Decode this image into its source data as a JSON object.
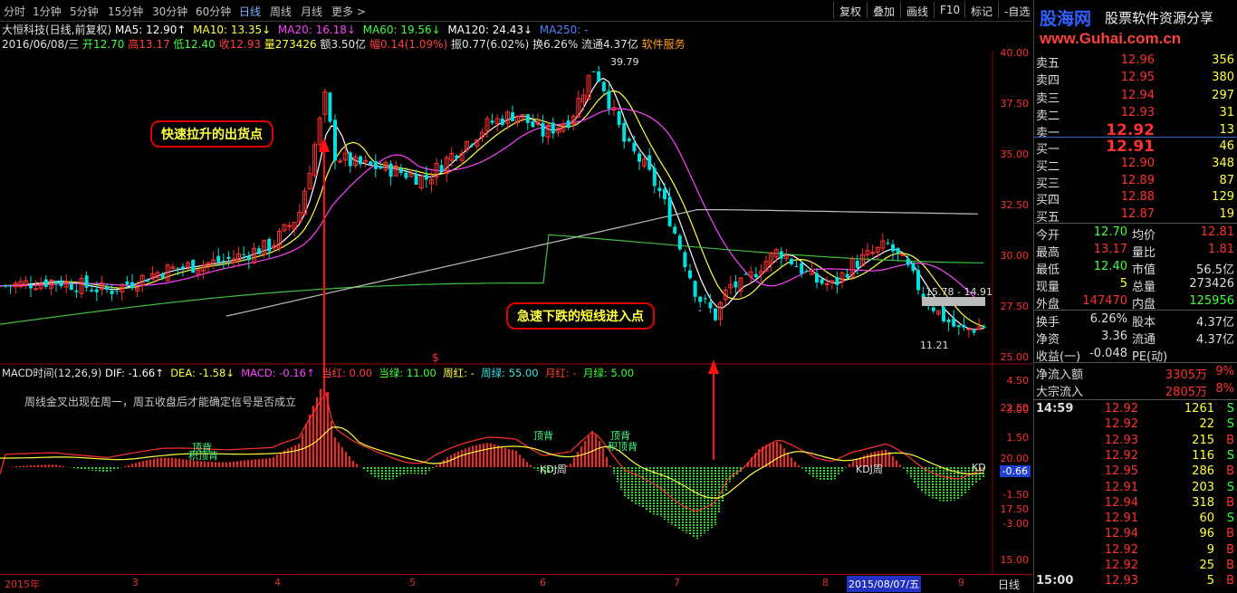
{
  "toolbar": {
    "items": [
      "分时",
      "1分钟",
      "5分钟",
      "15分钟",
      "30分钟",
      "60分钟",
      "日线",
      "周线",
      "月线",
      "更多 >"
    ],
    "right": [
      "复权",
      "叠加",
      "画线",
      "F10",
      "标记",
      "-自选"
    ]
  },
  "header": {
    "stock": "大恒科技(日线,前复权)",
    "ma5": "MA5: 12.90↑",
    "ma10": "MA10: 13.35↓",
    "ma20": "MA20: 16.18↓",
    "ma60": "MA60: 19.56↓",
    "ma120": "MA120: 24.43↓",
    "ma250": "MA250: -",
    "date": "2016/06/08/三",
    "open": "开12.70",
    "high": "高13.17",
    "low": "低12.40",
    "close": "收12.93",
    "vol": "量273426",
    "amount": "额3.50亿",
    "change": "幅0.14(1.09%)",
    "amp": "振0.77(6.02%)",
    "turnover": "换6.26%",
    "float": "流通4.37亿",
    "service": "软件服务"
  },
  "price_axis": [
    "40.00",
    "37.50",
    "35.00",
    "32.50",
    "30.00",
    "27.50",
    "25.00",
    "22.50",
    "20.00",
    "17.50",
    "15.00"
  ],
  "macd_axis": [
    "4.50",
    "3.00",
    "1.50",
    "-0.66",
    "-1.50",
    "-3.00"
  ],
  "annotations": {
    "callout_top": "快速拉升的出货点",
    "callout_bottom": "急速下跌的短线进入点",
    "peak_label": "39.79",
    "low_label": "11.21",
    "range_label": "15.78 - 14.91",
    "small_dash": "-"
  },
  "macd_header": {
    "name": "MACD时间(12,26,9)",
    "dif": "DIF: -1.66↑",
    "dea": "DEA: -1.58↓",
    "macd": "MACD: -0.16↑",
    "cur_red": "当红: 0.00",
    "cur_green": "当绿: 11.00",
    "week_red": "周红: -",
    "week_green": "周绿: 55.00",
    "month_red": "月红: -",
    "month_green": "月绿: 5.00"
  },
  "macd_notes": {
    "note": "周线金叉出现在周一，周五收盘后才能确定信号是否成立",
    "t1": "顶背",
    "t2": "积顶背",
    "t3": "顶背",
    "t4": "顶背",
    "t5": "积顶背",
    "kdj1": "KDJ周",
    "kdj2": "KDJ周",
    "kd": "KD",
    "dollar": "$"
  },
  "date_bar": {
    "labels": [
      "2015年",
      "3",
      "4",
      "5",
      "6",
      "7",
      "8",
      "2015/08/07/五",
      "9"
    ],
    "period": "日线"
  },
  "panel": {
    "logo": "股海网",
    "logo_sub": "股票软件资源分享",
    "url": "www.Guhai.com.cn",
    "asks": [
      {
        "label": "卖五",
        "price": "12.96",
        "vol": "356"
      },
      {
        "label": "卖四",
        "price": "12.95",
        "vol": "380"
      },
      {
        "label": "卖三",
        "price": "12.94",
        "vol": "297"
      },
      {
        "label": "卖二",
        "price": "12.93",
        "vol": "31"
      },
      {
        "label": "卖一",
        "price": "12.92",
        "vol": "13"
      }
    ],
    "bids": [
      {
        "label": "买一",
        "price": "12.91",
        "vol": "46"
      },
      {
        "label": "买二",
        "price": "12.90",
        "vol": "348"
      },
      {
        "label": "买三",
        "price": "12.89",
        "vol": "87"
      },
      {
        "label": "买四",
        "price": "12.88",
        "vol": "129"
      },
      {
        "label": "买五",
        "price": "12.87",
        "vol": "19"
      }
    ],
    "stats": [
      {
        "l1": "今开",
        "v1": "12.70",
        "l2": "均价",
        "v2": "12.81"
      },
      {
        "l1": "最高",
        "v1": "13.17",
        "l2": "量比",
        "v2": "1.81"
      },
      {
        "l1": "最低",
        "v1": "12.40",
        "l2": "市值",
        "v2": "56.5亿"
      },
      {
        "l1": "现量",
        "v1": "5",
        "l2": "总量",
        "v2": "273426"
      },
      {
        "l1": "外盘",
        "v1": "147470",
        "l2": "内盘",
        "v2": "125956"
      }
    ],
    "stats2": [
      {
        "l1": "换手",
        "v1": "6.26%",
        "l2": "股本",
        "v2": "4.37亿"
      },
      {
        "l1": "净资",
        "v1": "3.36",
        "l2": "流通",
        "v2": "4.37亿"
      },
      {
        "l1": "收益(一)",
        "v1": "-0.048",
        "l2": "PE(动)",
        "v2": ""
      }
    ],
    "flow": [
      {
        "l": "净流入额",
        "v": "3305万",
        "p": "9%"
      },
      {
        "l": "大宗流入",
        "v": "2805万",
        "p": "8%"
      }
    ],
    "ticks": [
      {
        "t": "14:59",
        "p": "12.92",
        "v": "1261",
        "s": "S"
      },
      {
        "t": "",
        "p": "12.92",
        "v": "22",
        "s": "S"
      },
      {
        "t": "",
        "p": "12.93",
        "v": "215",
        "s": "B"
      },
      {
        "t": "",
        "p": "12.92",
        "v": "116",
        "s": "S"
      },
      {
        "t": "",
        "p": "12.95",
        "v": "286",
        "s": "B"
      },
      {
        "t": "",
        "p": "12.91",
        "v": "203",
        "s": "S"
      },
      {
        "t": "",
        "p": "12.94",
        "v": "318",
        "s": "B"
      },
      {
        "t": "",
        "p": "12.91",
        "v": "60",
        "s": "S"
      },
      {
        "t": "",
        "p": "12.94",
        "v": "96",
        "s": "B"
      },
      {
        "t": "",
        "p": "12.92",
        "v": "9",
        "s": "B"
      },
      {
        "t": "",
        "p": "12.92",
        "v": "25",
        "s": "B"
      },
      {
        "t": "15:00",
        "p": "12.93",
        "v": "5",
        "s": "B"
      }
    ]
  },
  "colors": {
    "up": "#ff3030",
    "down": "#00e0e0",
    "ma5": "#ffffff",
    "ma10": "#ffff40",
    "ma20": "#ff40ff",
    "ma60": "#40c040",
    "ma120": "#c0c0c0"
  }
}
